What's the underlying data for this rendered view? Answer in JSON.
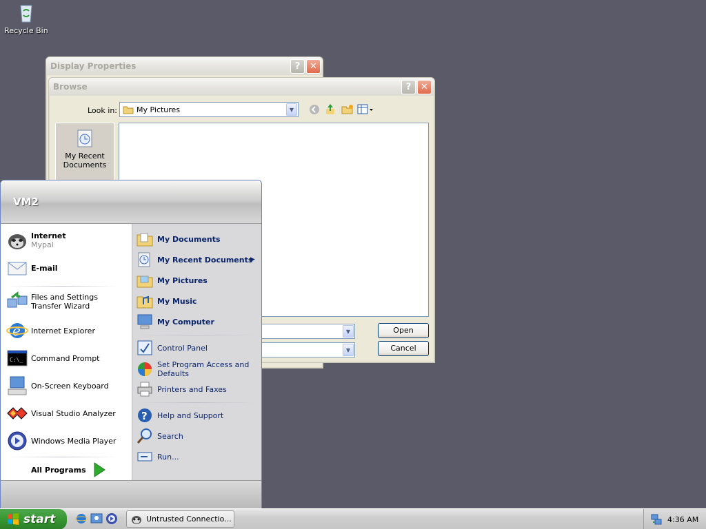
{
  "desktop": {
    "recycle_bin_label": "Recycle Bin"
  },
  "display_properties": {
    "title": "Display Properties",
    "help_btn": "?",
    "close_btn": "✕"
  },
  "browse": {
    "title": "Browse",
    "look_in_label": "Look in:",
    "look_in_value": "My Pictures",
    "places": [
      "My Recent Documents"
    ],
    "open_button": "Open",
    "cancel_button": "Cancel"
  },
  "start_menu": {
    "user_name": "VM2",
    "pinned": [
      {
        "title": "Internet",
        "subtitle": "Mypal"
      },
      {
        "title": "E-mail",
        "subtitle": ""
      }
    ],
    "recent": [
      "Files and Settings Transfer Wizard",
      "Internet Explorer",
      "Command Prompt",
      "On-Screen Keyboard",
      "Visual Studio Analyzer",
      "Windows Media Player"
    ],
    "all_programs": "All Programs",
    "places_main": [
      "My Documents",
      "My Recent Documents",
      "My Pictures",
      "My Music",
      "My Computer"
    ],
    "places_settings": [
      "Control Panel",
      "Set Program Access and Defaults",
      "Printers and Faxes"
    ],
    "places_tools": [
      "Help and Support",
      "Search",
      "Run..."
    ]
  },
  "taskbar": {
    "start_label": "start",
    "task_item": "Untrusted Connectio...",
    "clock": "4:36 AM"
  },
  "colors": {
    "desktop": "#5a5a68",
    "start_green": "#379632",
    "link_blue": "#0a246a"
  }
}
